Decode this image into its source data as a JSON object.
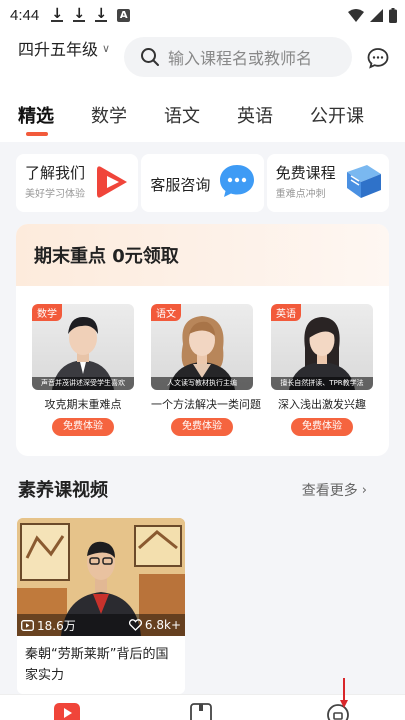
{
  "status_bar": {
    "time": "4:44",
    "a_badge": "A"
  },
  "header": {
    "grade": "四升五年级",
    "search_placeholder": "输入课程名或教师名"
  },
  "tabs": [
    {
      "label": "精选",
      "active": true
    },
    {
      "label": "数学",
      "active": false
    },
    {
      "label": "语文",
      "active": false
    },
    {
      "label": "英语",
      "active": false
    },
    {
      "label": "公开课",
      "active": false
    }
  ],
  "quick_links": [
    {
      "title": "了解我们",
      "subtitle": "美好学习体验",
      "icon": "play-triangle-icon"
    },
    {
      "title": "客服咨询",
      "subtitle": "",
      "icon": "chat-bubble-icon"
    },
    {
      "title": "免费课程",
      "subtitle": "重难点冲刺",
      "icon": "book-icon"
    }
  ],
  "promo": {
    "title": "期末重点 0元领取",
    "cards": [
      {
        "subject": "数学",
        "caption": "声音并茂讲述深受学生喜欢",
        "desc": "攻克期末重难点",
        "button": "免费体验"
      },
      {
        "subject": "语文",
        "caption": "人文读写教材执行主编",
        "desc": "一个方法解决一类问题",
        "button": "免费体验"
      },
      {
        "subject": "英语",
        "caption": "擅长自然拼读、TPR教学法",
        "desc": "深入浅出激发兴趣",
        "button": "免费体验"
      }
    ]
  },
  "section": {
    "title": "素养课视频",
    "more": "查看更多"
  },
  "video": {
    "plays": "18.6万",
    "likes": "6.8k+",
    "title": "秦朝“劳斯莱斯”背后的国家实力"
  },
  "colors": {
    "accent": "#f25a3b",
    "button": "#f5643f"
  }
}
